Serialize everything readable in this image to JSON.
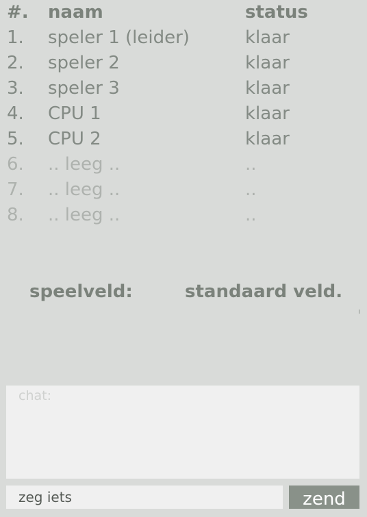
{
  "table": {
    "header": {
      "number": "#.",
      "name": "naam",
      "status": "status"
    },
    "rows": [
      {
        "number": "1.",
        "name": "speler 1 (leider)",
        "status": "klaar"
      },
      {
        "number": "2.",
        "name": "speler 2",
        "status": "klaar"
      },
      {
        "number": "3.",
        "name": "speler 3",
        "status": "klaar"
      },
      {
        "number": "4.",
        "name": "CPU 1",
        "status": "klaar"
      },
      {
        "number": "5.",
        "name": "CPU 2",
        "status": "klaar"
      },
      {
        "number": "6.",
        "name": ".. leeg ..",
        "status": ".."
      },
      {
        "number": "7.",
        "name": ".. leeg ..",
        "status": ".."
      },
      {
        "number": "8.",
        "name": ".. leeg ..",
        "status": ".."
      }
    ]
  },
  "field": {
    "label": "speelveld:",
    "value": "standaard veld."
  },
  "chat": {
    "label": "chat:",
    "input_value": "zeg iets",
    "send_label": "zend"
  }
}
